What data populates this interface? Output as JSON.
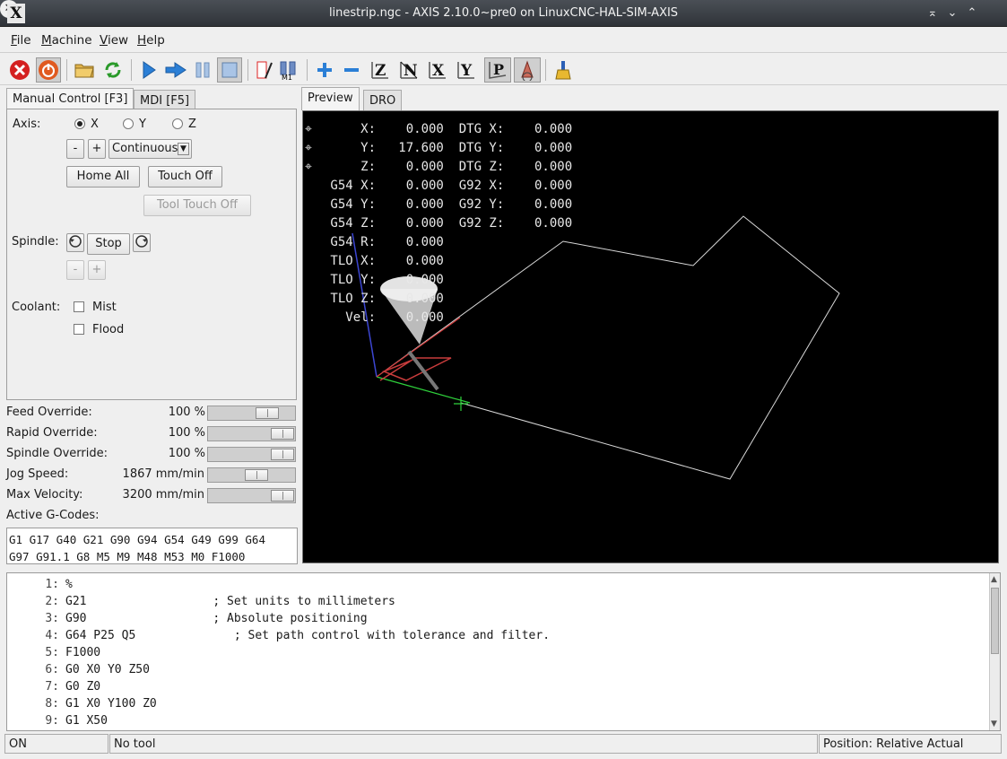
{
  "window": {
    "title": "linestrip.ngc - AXIS 2.10.0~pre0 on LinuxCNC-HAL-SIM-AXIS",
    "logo": "X",
    "buttons": [
      "keep-above-icon",
      "minimize-icon",
      "maximize-icon",
      "close-icon"
    ]
  },
  "menu": [
    {
      "label": "File",
      "mnemonic": "F",
      "rest": "ile"
    },
    {
      "label": "Machine",
      "mnemonic": "M",
      "rest": "achine"
    },
    {
      "label": "View",
      "mnemonic": "V",
      "rest": "iew"
    },
    {
      "label": "Help",
      "mnemonic": "H",
      "rest": "elp"
    }
  ],
  "toolbar_icons": [
    "estop",
    "machine-power",
    "open-file",
    "reload",
    "run",
    "step",
    "pause",
    "stop",
    "toggle-skip-lines",
    "toggle-optional-stop",
    "zoom-in",
    "zoom-out",
    "view-z",
    "view-z2",
    "view-x",
    "view-y",
    "view-p",
    "rotate-view",
    "clear-plot"
  ],
  "tabs": {
    "left": [
      "Manual Control [F3]",
      "MDI [F5]"
    ],
    "right": [
      "Preview",
      "DRO"
    ]
  },
  "manual": {
    "axis_label": "Axis:",
    "axes": [
      "X",
      "Y",
      "Z"
    ],
    "selected_axis": "X",
    "jog_minus": "-",
    "jog_plus": "+",
    "jog_mode": "Continuous",
    "home_all": "Home All",
    "touch_off": "Touch Off",
    "tool_touch_off": "Tool Touch Off",
    "spindle_label": "Spindle:",
    "spindle_stop": "Stop",
    "spindle_minus": "-",
    "spindle_plus": "+",
    "coolant_label": "Coolant:",
    "mist": "Mist",
    "flood": "Flood"
  },
  "overrides": [
    {
      "label": "Feed Override:",
      "value": "100 %",
      "level": 0.75
    },
    {
      "label": "Rapid Override:",
      "value": "100 %",
      "level": 1.0
    },
    {
      "label": "Spindle Override:",
      "value": "100 %",
      "level": 1.0
    },
    {
      "label": "Jog Speed:",
      "value": "1867 mm/min",
      "level": 0.58
    },
    {
      "label": "Max Velocity:",
      "value": "3200 mm/min",
      "level": 1.0
    }
  ],
  "active_gcodes": {
    "label": "Active G-Codes:",
    "line1": "G1 G17 G40 G21 G90 G94 G54 G49 G99 G64",
    "line2": "G97 G91.1 G8 M5 M9 M48 M53 M0 F1000"
  },
  "dro": [
    {
      "text": "     X:    0.000  DTG X:    0.000",
      "homed": true
    },
    {
      "text": "     Y:   17.600  DTG Y:    0.000",
      "homed": true
    },
    {
      "text": "     Z:    0.000  DTG Z:    0.000",
      "homed": true
    },
    {
      "text": " G54 X:    0.000  G92 X:    0.000",
      "homed": false
    },
    {
      "text": " G54 Y:    0.000  G92 Y:    0.000",
      "homed": false
    },
    {
      "text": " G54 Z:    0.000  G92 Z:    0.000",
      "homed": false
    },
    {
      "text": " G54 R:    0.000",
      "homed": false
    },
    {
      "text": " TLO X:    0.000",
      "homed": false
    },
    {
      "text": " TLO Y:    0.000",
      "homed": false
    },
    {
      "text": " TLO Z:    0.000",
      "homed": false
    },
    {
      "text": "   Vel:    0.000",
      "homed": false
    }
  ],
  "program": [
    {
      "n": "1:",
      "code": "%"
    },
    {
      "n": "2:",
      "code": "G21                  ; Set units to millimeters"
    },
    {
      "n": "3:",
      "code": "G90                  ; Absolute positioning"
    },
    {
      "n": "4:",
      "code": "G64 P25 Q5              ; Set path control with tolerance and filter."
    },
    {
      "n": "5:",
      "code": "F1000"
    },
    {
      "n": "6:",
      "code": "G0 X0 Y0 Z50"
    },
    {
      "n": "7:",
      "code": "G0 Z0"
    },
    {
      "n": "8:",
      "code": "G1 X0 Y100 Z0"
    },
    {
      "n": "9:",
      "code": "G1 X50"
    }
  ],
  "statusbar": {
    "state": "ON",
    "tool": "No tool",
    "position": "Position: Relative Actual"
  },
  "colors": {
    "preview_bg": "#000000",
    "toolpath": "#d9d9d9",
    "x_axis": "#d23c3c",
    "y_axis": "#2fd23c",
    "z_axis": "#3c46d2"
  }
}
